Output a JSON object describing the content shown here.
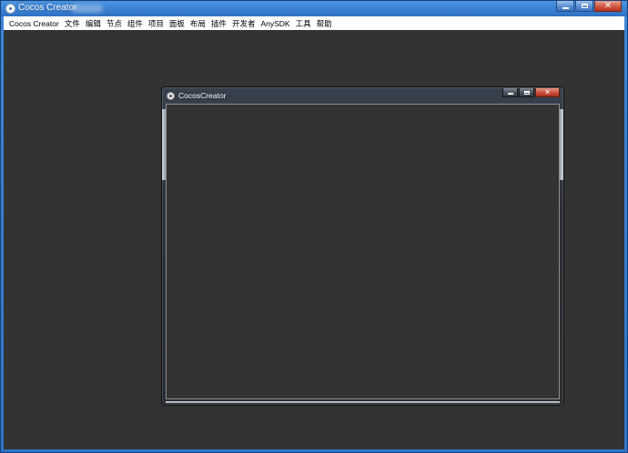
{
  "main_window": {
    "title": "Cocos Creator",
    "controls": {
      "minimize_icon": "minimize-icon",
      "maximize_icon": "maximize-icon",
      "close_icon": "close-icon"
    }
  },
  "menubar": {
    "items": [
      {
        "label": "Cocos Creator"
      },
      {
        "label": "文件"
      },
      {
        "label": "编辑"
      },
      {
        "label": "节点"
      },
      {
        "label": "组件"
      },
      {
        "label": "项目"
      },
      {
        "label": "面板"
      },
      {
        "label": "布局"
      },
      {
        "label": "插件"
      },
      {
        "label": "开发者"
      },
      {
        "label": "AnySDK"
      },
      {
        "label": "工具"
      },
      {
        "label": "帮助"
      }
    ]
  },
  "child_window": {
    "title": "CocosCreator",
    "controls": {
      "minimize_icon": "minimize-icon",
      "maximize_icon": "maximize-icon",
      "close_icon": "close-icon"
    }
  },
  "colors": {
    "canvas_background": "#333333",
    "titlebar_blue": "#2f74c8",
    "close_red": "#c8503a"
  }
}
